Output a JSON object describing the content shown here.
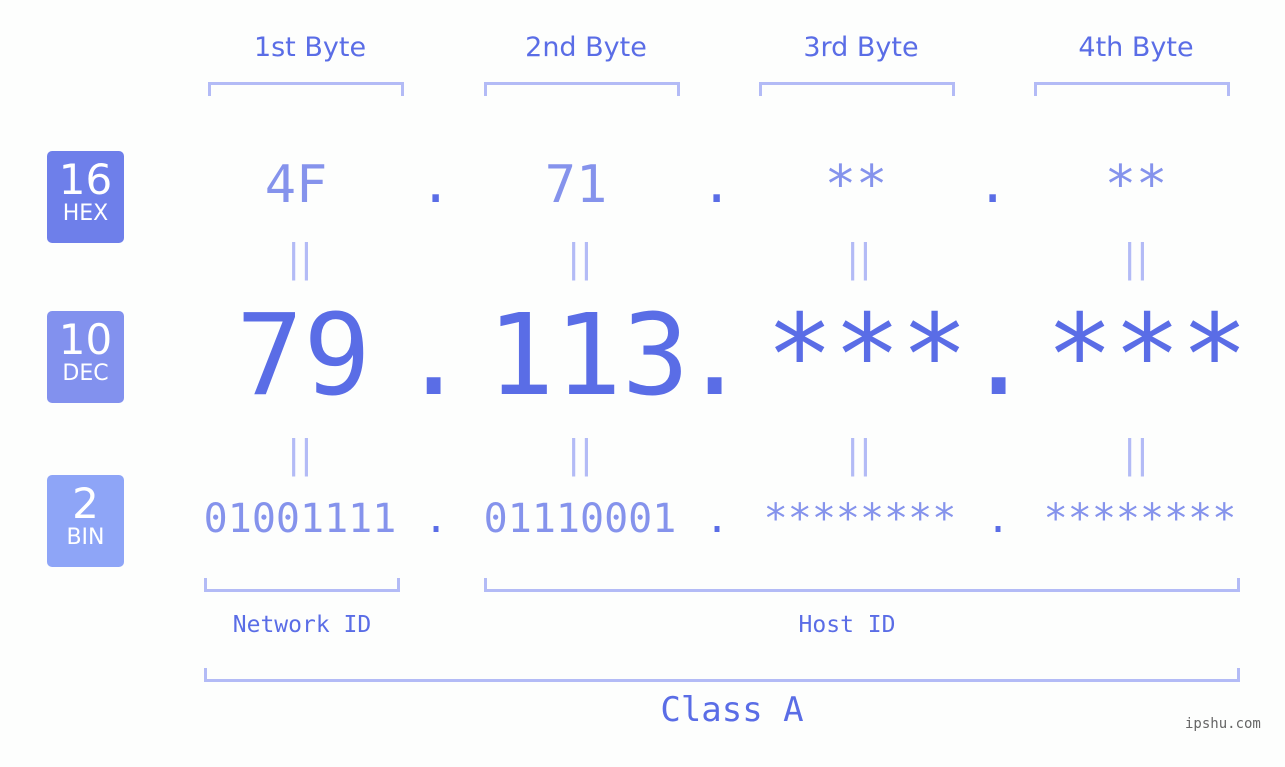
{
  "badges": [
    {
      "num": "16",
      "label": "HEX",
      "color": "#6e7fea"
    },
    {
      "num": "10",
      "label": "DEC",
      "color": "#8291ee"
    },
    {
      "num": "2",
      "label": "BIN",
      "color": "#8ea5f7"
    }
  ],
  "byte_headers": [
    "1st Byte",
    "2nd Byte",
    "3rd Byte",
    "4th Byte"
  ],
  "hex": [
    "4F",
    "71",
    "**",
    "**"
  ],
  "dec": [
    "79",
    "113",
    "***",
    "***"
  ],
  "bin": [
    "01001111",
    "01110001",
    "********",
    "********"
  ],
  "separator": ".",
  "equals": "=",
  "network_label": "Network ID",
  "host_label": "Host ID",
  "class_label": "Class A",
  "watermark": "ipshu.com",
  "colors": {
    "accent": "#5a6de6",
    "light": "#8593ec",
    "bracket": "#b3bbf6"
  }
}
